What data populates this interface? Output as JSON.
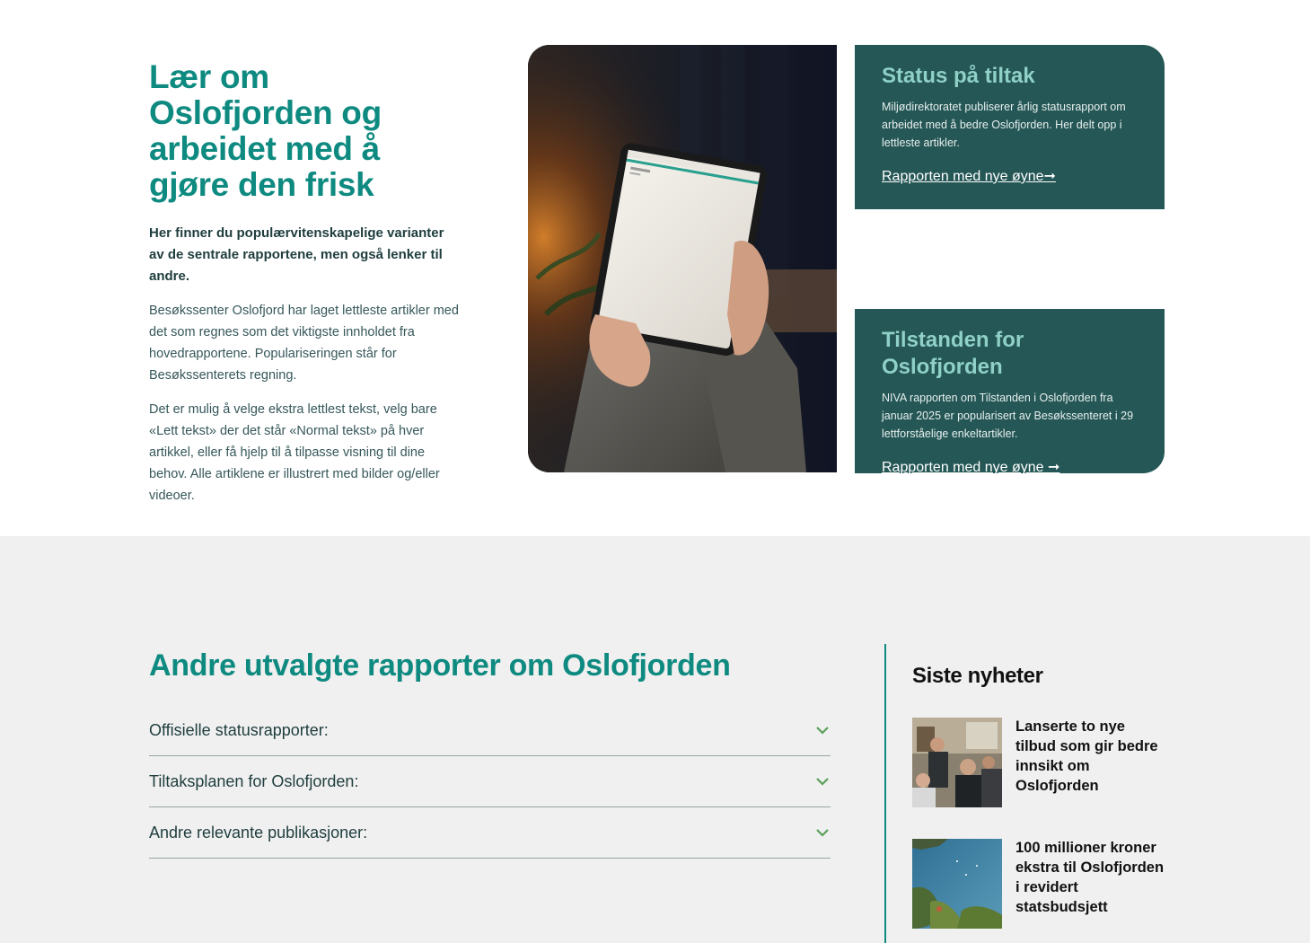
{
  "intro": {
    "heading": "Lær om Oslofjorden og arbeidet med å gjøre den frisk",
    "lead": "Her finner du populærvitenskapelige varianter av de sentrale rapportene, men også lenker til andre.",
    "paragraph1": "Besøkssenter Oslofjord har laget lettleste artikler med det som regnes som det viktigste innholdet fra hovedrapportene. Populariseringen står for Besøkssenterets regning.",
    "paragraph2": "Det er mulig å velge ekstra lettlest tekst, velg bare «Lett tekst» der det står «Normal tekst» på hver artikkel, eller få hjelp til å tilpasse visning til dine behov. Alle artiklene er illustrert med bilder og/eller videoer."
  },
  "cards": [
    {
      "title": "Status på tiltak",
      "text": "Miljødirektoratet publiserer årlig statusrapport om arbeidet med å bedre Oslofjorden. Her delt opp i lettleste artikler.",
      "link": "Rapporten med nye øyne➞"
    },
    {
      "title": "Tilstanden for Oslofjorden",
      "text": "NIVA rapporten om Tilstanden i Oslofjorden fra januar 2025 er popularisert av Besøkssenteret i 29 lettforståelige enkeltartikler.",
      "link": "Rapporten med nye øyne ➞"
    }
  ],
  "reports": {
    "title": "Andre utvalgte rapporter om Oslofjorden",
    "items": [
      {
        "label": "Offisielle statusrapporter:"
      },
      {
        "label": "Tiltaksplanen for Oslofjorden:"
      },
      {
        "label": "Andre relevante publikasjoner:"
      }
    ]
  },
  "news": {
    "title": "Siste nyheter",
    "items": [
      {
        "title": "Lanserte to nye tilbud som gir bedre innsikt om Oslofjorden"
      },
      {
        "title": "100 millioner kroner ekstra til Oslofjorden i revidert statsbudsjett"
      }
    ]
  },
  "colors": {
    "accent": "#0e8a80",
    "card": "#255756",
    "card_title": "#8fd0c7",
    "chevron": "#5aa05a"
  },
  "icons": {
    "chevron": "chevron-down-icon"
  }
}
